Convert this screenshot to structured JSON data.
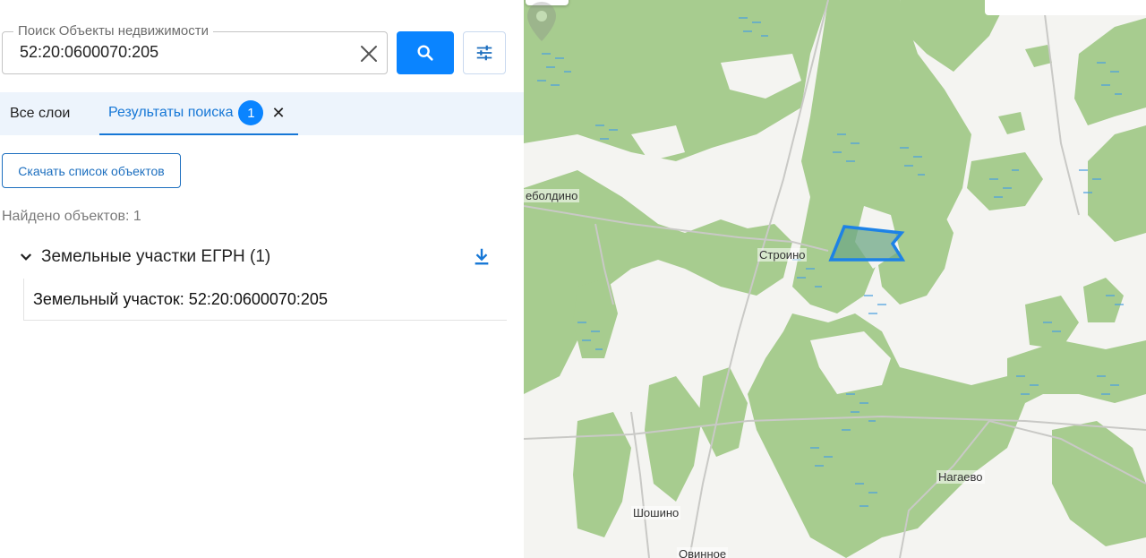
{
  "search": {
    "legend": "Поиск Объекты недвижимости",
    "value": "52:20:0600070:205"
  },
  "tabs": {
    "all_label": "Все слои",
    "results_label": "Результаты поиска",
    "results_count": "1",
    "close_symbol": "✕"
  },
  "actions": {
    "download_list_label": "Скачать список объектов"
  },
  "results": {
    "found_text": "Найдено объектов: 1",
    "group_title": "Земельные участки ЕГРН (1)",
    "items": [
      "Земельный участок: 52:20:0600070:205"
    ]
  },
  "map": {
    "places": [
      "еболдино",
      "Строино",
      "Нагаево",
      "Шошино",
      "Овинное"
    ],
    "colors": {
      "forest": "#a7cc8f",
      "background": "#f4f4f1",
      "water": "#4a9fe0",
      "parcel_fill": "#6fa886",
      "parcel_stroke": "#1d82e6"
    }
  },
  "colors": {
    "accent": "#0a84ff",
    "tab_bg": "#edf4fc",
    "link": "#1677d6"
  },
  "icons": [
    "close-icon",
    "search-icon",
    "filter-icon",
    "chevron-down-icon",
    "download-icon",
    "location-pin-icon"
  ]
}
